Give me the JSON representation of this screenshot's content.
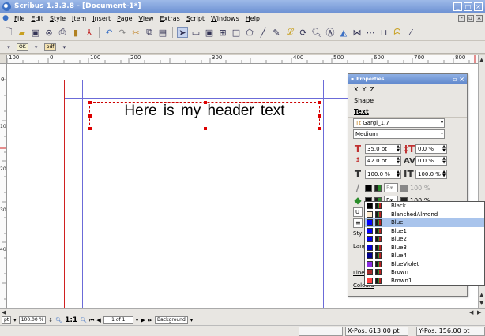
{
  "window": {
    "title": "Scribus 1.3.3.8 - [Document-1*]"
  },
  "menu": [
    "File",
    "Edit",
    "Style",
    "Item",
    "Insert",
    "Page",
    "View",
    "Extras",
    "Script",
    "Windows",
    "Help"
  ],
  "toolbar2": {
    "ok_label": "OK"
  },
  "ruler": {
    "h_labels": [
      "100",
      "0",
      "100",
      "200",
      "300",
      "400",
      "500",
      "600",
      "700",
      "800"
    ],
    "v_labels": [
      "0",
      "100",
      "200",
      "300",
      "400"
    ]
  },
  "document": {
    "header_text": "Here is my header text"
  },
  "properties": {
    "title": "Properties",
    "sections": [
      "X, Y, Z",
      "Shape",
      "Text"
    ],
    "font": "Gargi_1.7",
    "font_style": "Medium",
    "font_size": "35.0 pt",
    "scale_h": "0.0 %",
    "line_spacing": "42.0 pt",
    "tracking": "0.0 %",
    "width_scale": "100.0 %",
    "height_scale": "100.0 %",
    "stroke_shade": "100 %",
    "fill_shade": "100 %",
    "partial_labels": [
      "Styl",
      "Lang",
      "Line"
    ],
    "colours_label": "Colours"
  },
  "colors": [
    {
      "name": "Black",
      "hex": "#000000"
    },
    {
      "name": "BlanchedAlmond",
      "hex": "#ffebcd"
    },
    {
      "name": "Blue",
      "hex": "#0000ff"
    },
    {
      "name": "Blue1",
      "hex": "#0000ff"
    },
    {
      "name": "Blue2",
      "hex": "#0000ee"
    },
    {
      "name": "Blue3",
      "hex": "#0000cd"
    },
    {
      "name": "Blue4",
      "hex": "#00008b"
    },
    {
      "name": "BlueViolet",
      "hex": "#8a2be2"
    },
    {
      "name": "Brown",
      "hex": "#a52a2a"
    },
    {
      "name": "Brown1",
      "hex": "#ff4040"
    }
  ],
  "selected_color": "Blue",
  "statusbar": {
    "unit": "pt",
    "zoom": "100.00 %",
    "ratio": "1:1",
    "page": "1 of 1",
    "layer": "Background"
  },
  "position": {
    "x": "X-Pos: 613.00 pt",
    "y": "Y-Pos: 156.00 pt"
  }
}
